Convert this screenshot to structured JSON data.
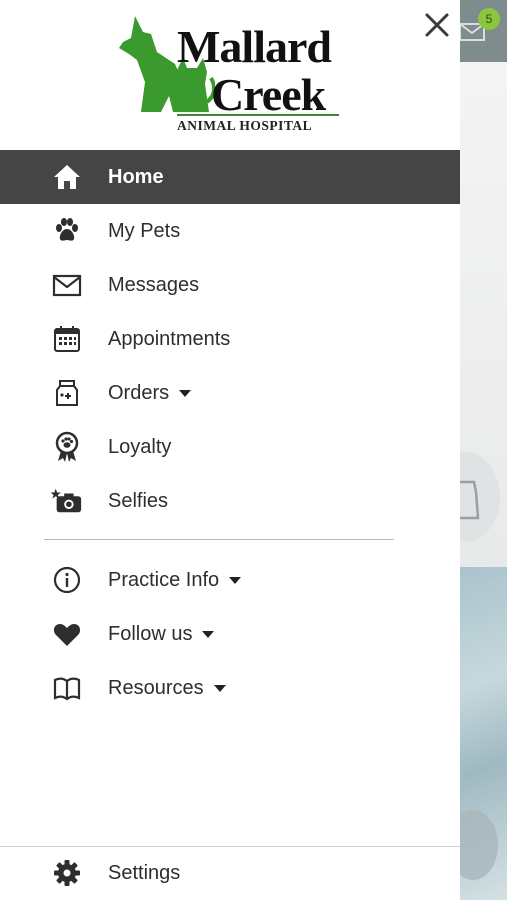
{
  "app": {
    "logo": {
      "line1": "Mallard",
      "line2": "Creek",
      "line3": "ANIMAL HOSPITAL"
    }
  },
  "background": {
    "mail_badge": "5"
  },
  "menu": {
    "primary": [
      {
        "label": "Home",
        "icon": "home-icon",
        "active": true
      },
      {
        "label": "My Pets",
        "icon": "paw-icon"
      },
      {
        "label": "Messages",
        "icon": "envelope-icon"
      },
      {
        "label": "Appointments",
        "icon": "calendar-icon"
      },
      {
        "label": "Orders",
        "icon": "food-bag-icon",
        "dropdown": true
      },
      {
        "label": "Loyalty",
        "icon": "award-ribbon-icon"
      },
      {
        "label": "Selfies",
        "icon": "camera-star-icon"
      }
    ],
    "secondary": [
      {
        "label": "Practice Info",
        "icon": "info-icon",
        "dropdown": true
      },
      {
        "label": "Follow us",
        "icon": "heart-icon",
        "dropdown": true
      },
      {
        "label": "Resources",
        "icon": "book-icon",
        "dropdown": true
      }
    ],
    "settings": {
      "label": "Settings",
      "icon": "gear-icon"
    }
  },
  "colors": {
    "active_bg": "#454545",
    "brand_green": "#3a9a2e",
    "text": "#2e2e2e"
  }
}
